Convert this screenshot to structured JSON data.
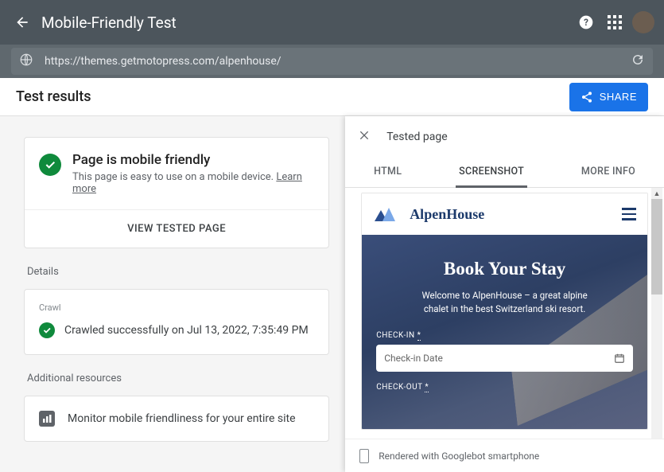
{
  "header": {
    "title": "Mobile-Friendly Test"
  },
  "urlbar": {
    "url": "https://themes.getmotopress.com/alpenhouse/"
  },
  "results": {
    "heading": "Test results",
    "share_label": "SHARE"
  },
  "status": {
    "title": "Page is mobile friendly",
    "subtitle": "This page is easy to use on a mobile device.",
    "learn_more": "Learn more",
    "view_tested": "VIEW TESTED PAGE"
  },
  "details": {
    "label": "Details",
    "crawl_label": "Crawl",
    "crawl_result": "Crawled successfully on Jul 13, 2022, 7:35:49 PM"
  },
  "additional": {
    "label": "Additional resources",
    "monitor_text": "Monitor mobile friendliness for your entire site"
  },
  "right_panel": {
    "title": "Tested page",
    "tabs": {
      "html": "HTML",
      "screenshot": "SCREENSHOT",
      "more": "MORE INFO"
    },
    "footer": "Rendered with Googlebot smartphone"
  },
  "preview": {
    "brand": "AlpenHouse",
    "hero_title": "Book Your Stay",
    "hero_sub": "Welcome to AlpenHouse – a great alpine chalet in the best Switzerland ski resort.",
    "checkin_label": "CHECK-IN",
    "checkin_placeholder": "Check-in Date",
    "checkout_label": "CHECK-OUT"
  },
  "colors": {
    "primary_blue": "#1a73e8",
    "success_green": "#0f8a3c"
  }
}
